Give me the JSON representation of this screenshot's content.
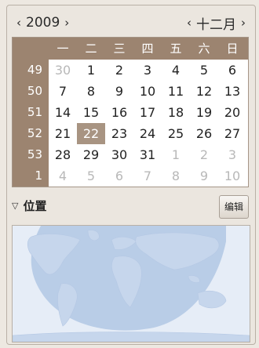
{
  "header": {
    "year": "2009",
    "month": "十二月",
    "prev_arrow": "‹",
    "next_arrow": "›"
  },
  "weekdays": [
    "一",
    "二",
    "三",
    "四",
    "五",
    "六",
    "日"
  ],
  "week_numbers": [
    "49",
    "50",
    "51",
    "52",
    "53",
    "1"
  ],
  "weeks": [
    [
      {
        "d": "30",
        "o": true
      },
      {
        "d": "1"
      },
      {
        "d": "2"
      },
      {
        "d": "3"
      },
      {
        "d": "4"
      },
      {
        "d": "5"
      },
      {
        "d": "6"
      }
    ],
    [
      {
        "d": "7"
      },
      {
        "d": "8"
      },
      {
        "d": "9"
      },
      {
        "d": "10"
      },
      {
        "d": "11"
      },
      {
        "d": "12"
      },
      {
        "d": "13"
      }
    ],
    [
      {
        "d": "14"
      },
      {
        "d": "15"
      },
      {
        "d": "16"
      },
      {
        "d": "17"
      },
      {
        "d": "18"
      },
      {
        "d": "19"
      },
      {
        "d": "20"
      }
    ],
    [
      {
        "d": "21"
      },
      {
        "d": "22",
        "s": true
      },
      {
        "d": "23"
      },
      {
        "d": "24"
      },
      {
        "d": "25"
      },
      {
        "d": "26"
      },
      {
        "d": "27"
      }
    ],
    [
      {
        "d": "28"
      },
      {
        "d": "29"
      },
      {
        "d": "30"
      },
      {
        "d": "31"
      },
      {
        "d": "1",
        "o": true
      },
      {
        "d": "2",
        "o": true
      },
      {
        "d": "3",
        "o": true
      }
    ],
    [
      {
        "d": "4",
        "o": true
      },
      {
        "d": "5",
        "o": true
      },
      {
        "d": "6",
        "o": true
      },
      {
        "d": "7",
        "o": true
      },
      {
        "d": "8",
        "o": true
      },
      {
        "d": "9",
        "o": true
      },
      {
        "d": "10",
        "o": true
      }
    ]
  ],
  "location": {
    "label": "位置",
    "edit_label": "编辑",
    "toggle_icon": "triangle-down-icon"
  },
  "colors": {
    "header_bg": "#9c8470",
    "selected_bg": "#a89482",
    "map_ocean": "#e7edf7",
    "map_night": "#a9c1e2",
    "map_land": "#c4d4ea"
  }
}
